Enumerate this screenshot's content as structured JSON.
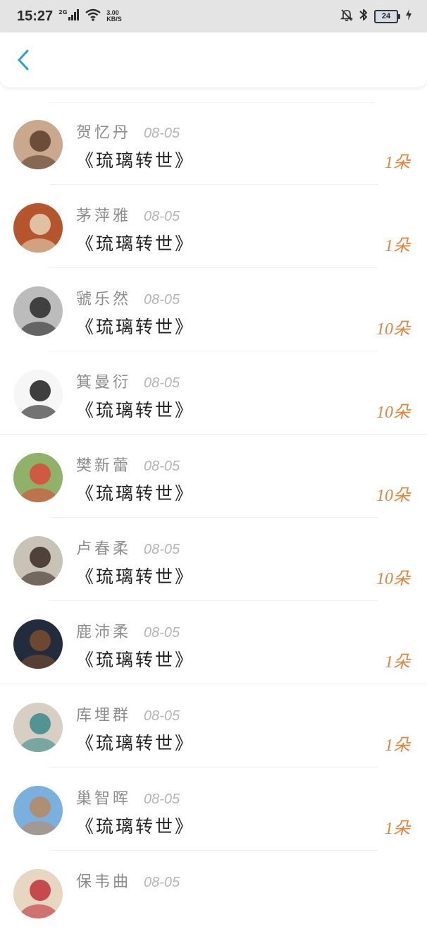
{
  "status_bar": {
    "time": "15:27",
    "network": "2G",
    "speed_value": "3.00",
    "speed_unit": "KB/S",
    "battery": "24",
    "icons": [
      "signal-icon",
      "wifi-icon",
      "mute-bell-icon",
      "bluetooth-icon",
      "battery-icon",
      "charging-icon"
    ]
  },
  "header": {
    "back_icon": "chevron-left-icon",
    "accent_color": "#2b9be3"
  },
  "rows": [
    {
      "name": "贺忆丹",
      "date": "08-05",
      "title": "《琉璃转世》",
      "count": "1朵",
      "avatar_colors": [
        "#c9a88e",
        "#5a3d2c"
      ]
    },
    {
      "name": "茅萍雅",
      "date": "08-05",
      "title": "《琉璃转世》",
      "count": "1朵",
      "avatar_colors": [
        "#b4552b",
        "#e6d3b8"
      ]
    },
    {
      "name": "虢乐然",
      "date": "08-05",
      "title": "《琉璃转世》",
      "count": "10朵",
      "avatar_colors": [
        "#bcbcbc",
        "#2a2a2a"
      ]
    },
    {
      "name": "箕曼衍",
      "date": "08-05",
      "title": "《琉璃转世》",
      "count": "10朵",
      "avatar_colors": [
        "#f6f6f6",
        "#1d1d1d"
      ]
    },
    {
      "name": "樊新蕾",
      "date": "08-05",
      "title": "《琉璃转世》",
      "count": "10朵",
      "avatar_colors": [
        "#8fb168",
        "#d94b3d"
      ]
    },
    {
      "name": "卢春柔",
      "date": "08-05",
      "title": "《琉璃转世》",
      "count": "10朵",
      "avatar_colors": [
        "#c9c2b6",
        "#3a2c25"
      ]
    },
    {
      "name": "鹿沛柔",
      "date": "08-05",
      "title": "《琉璃转世》",
      "count": "1朵",
      "avatar_colors": [
        "#232c3d",
        "#7a4c2e"
      ]
    },
    {
      "name": "库埋群",
      "date": "08-05",
      "title": "《琉璃转世》",
      "count": "1朵",
      "avatar_colors": [
        "#d8cfc4",
        "#3b8a8a"
      ]
    },
    {
      "name": "巢智晖",
      "date": "08-05",
      "title": "《琉璃转世》",
      "count": "1朵",
      "avatar_colors": [
        "#7ab0de",
        "#b98a62"
      ]
    },
    {
      "name": "保韦曲",
      "date": "08-05",
      "title": "",
      "count": "",
      "avatar_colors": [
        "#e7d6c2",
        "#c0303a"
      ]
    }
  ],
  "colors": {
    "count": "#e0853e",
    "name": "#8c8c8c",
    "date": "#b5b5b5",
    "title": "#222222"
  }
}
